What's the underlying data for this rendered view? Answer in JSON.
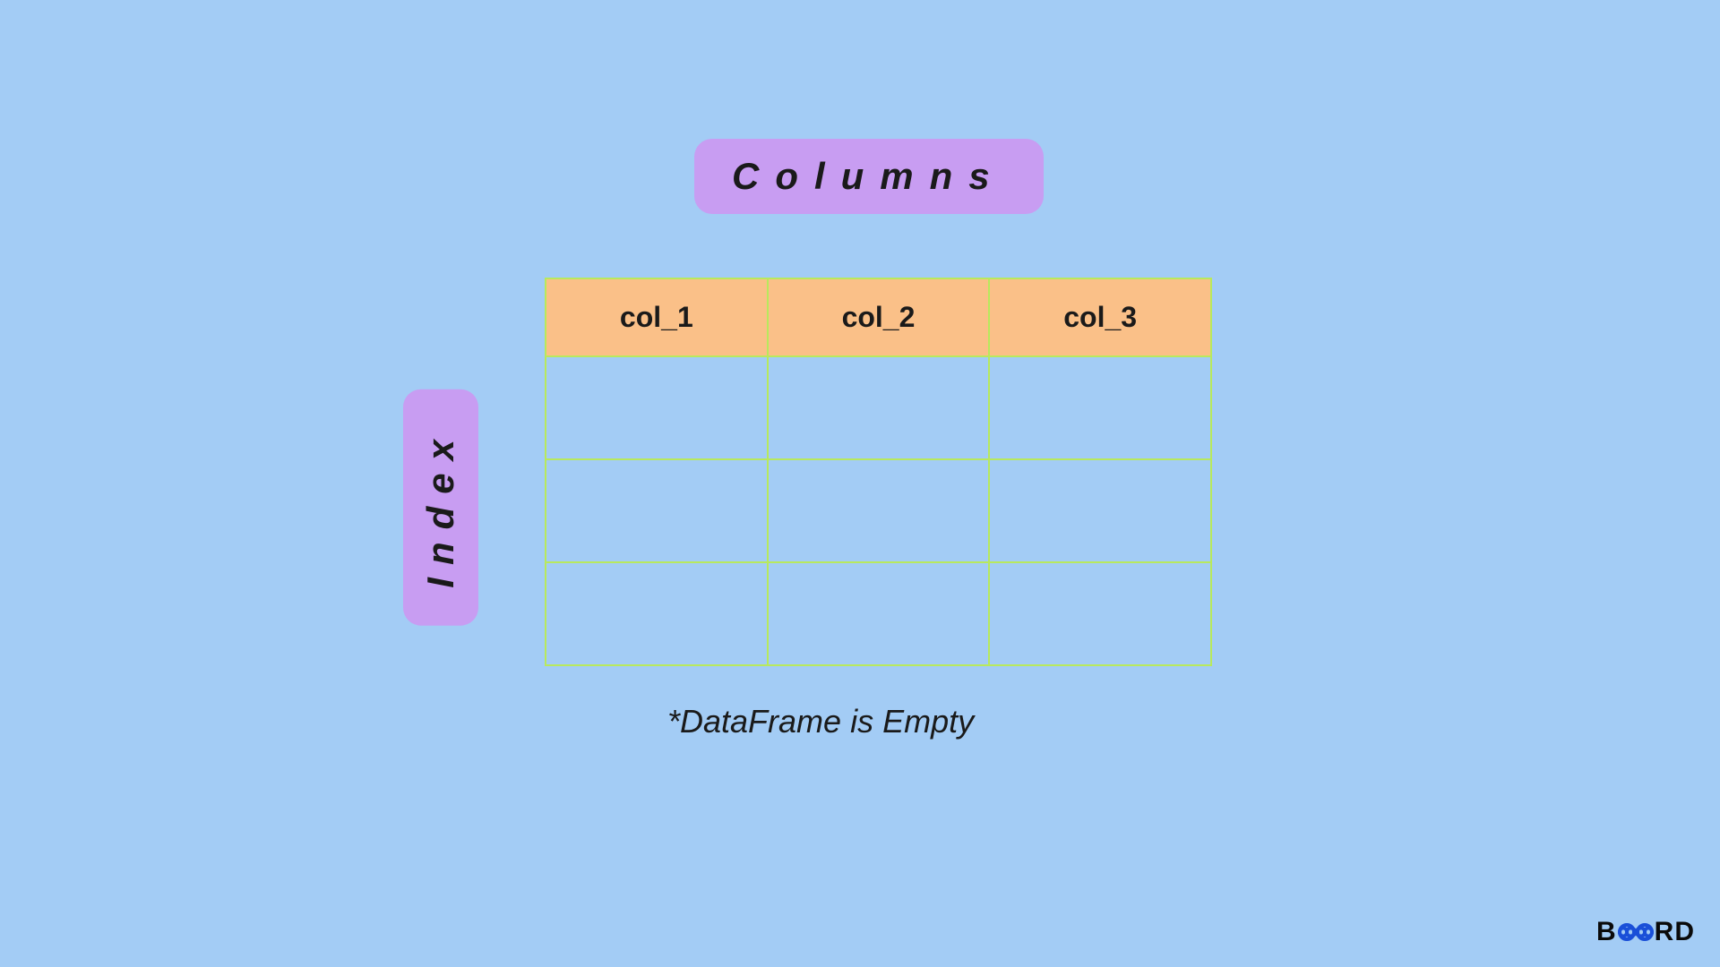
{
  "labels": {
    "columns": "Columns",
    "index": "Index"
  },
  "table": {
    "headers": [
      "col_1",
      "col_2",
      "col_3"
    ],
    "empty_rows": 3
  },
  "caption": "*DataFrame is Empty",
  "logo": {
    "part1": "B",
    "part2": "RD"
  },
  "colors": {
    "background": "#a3ccf5",
    "label_bg": "#c89df2",
    "header_bg": "#fac088",
    "border": "#b8e95d",
    "text": "#1a1a1a",
    "logo_accent": "#1a4fd8"
  }
}
